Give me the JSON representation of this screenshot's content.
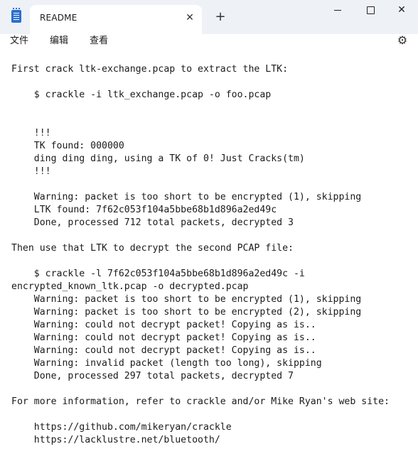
{
  "window": {
    "tab_title": "README",
    "tab_close_glyph": "✕",
    "new_tab_glyph": "+",
    "minimize_icon": "minimize-icon",
    "maximize_icon": "maximize-icon",
    "close_glyph": "✕"
  },
  "menu": {
    "file": "文件",
    "edit": "编辑",
    "view": "查看",
    "settings_glyph": "⚙"
  },
  "document": {
    "lines": [
      "First crack ltk-exchange.pcap to extract the LTK:",
      "",
      "    $ crackle -i ltk_exchange.pcap -o foo.pcap",
      "",
      "",
      "    !!!",
      "    TK found: 000000",
      "    ding ding ding, using a TK of 0! Just Cracks(tm)",
      "    !!!",
      "",
      "    Warning: packet is too short to be encrypted (1), skipping",
      "    LTK found: 7f62c053f104a5bbe68b1d896a2ed49c",
      "    Done, processed 712 total packets, decrypted 3",
      "",
      "Then use that LTK to decrypt the second PCAP file:",
      "",
      "    $ crackle -l 7f62c053f104a5bbe68b1d896a2ed49c -i",
      "encrypted_known_ltk.pcap -o decrypted.pcap",
      "    Warning: packet is too short to be encrypted (1), skipping",
      "    Warning: packet is too short to be encrypted (2), skipping",
      "    Warning: could not decrypt packet! Copying as is..",
      "    Warning: could not decrypt packet! Copying as is..",
      "    Warning: could not decrypt packet! Copying as is..",
      "    Warning: invalid packet (length too long), skipping",
      "    Done, processed 297 total packets, decrypted 7",
      "",
      "For more information, refer to crackle and/or Mike Ryan's web site:",
      "",
      "    https://github.com/mikeryan/crackle",
      "    https://lacklustre.net/bluetooth/"
    ]
  }
}
